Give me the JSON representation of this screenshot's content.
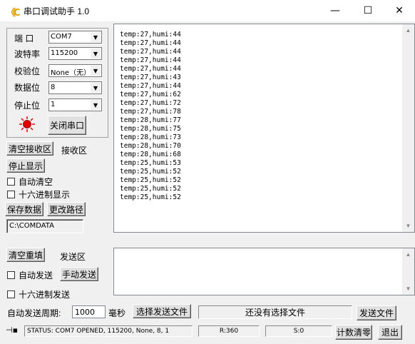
{
  "titlebar": {
    "app_title": "串口调试助手 1.0",
    "app_icon": "app-logo-icon",
    "minimize_glyph": "—",
    "maximize_glyph": "☐",
    "close_glyph": "✕"
  },
  "settings": {
    "port_label": "端  口",
    "port_value": "COM7",
    "baud_label": "波特率",
    "baud_value": "115200",
    "parity_label": "校验位",
    "parity_value": "None（无）",
    "databits_label": "数据位",
    "databits_value": "8",
    "stopbits_label": "停止位",
    "stopbits_value": "1",
    "close_port_label": "关闭串口",
    "status_led_color": "#e00000"
  },
  "receive": {
    "clear_label": "清空接收区",
    "area_label": "接收区",
    "stop_display_label": "停止显示",
    "auto_clear_label": "自动清空",
    "hex_display_label": "十六进制显示",
    "save_data_label": "保存数据",
    "change_path_label": "更改路径",
    "path_value": "C:\\COMDATA",
    "lines": [
      "temp:27,humi:44",
      "temp:27,humi:44",
      "temp:27,humi:44",
      "temp:27,humi:44",
      "temp:27,humi:44",
      "temp:27,humi:43",
      "temp:27,humi:44",
      "temp:27,humi:62",
      "temp:27,humi:72",
      "temp:27,humi:78",
      "temp:28,humi:77",
      "temp:28,humi:75",
      "temp:28,humi:73",
      "temp:28,humi:70",
      "temp:28,humi:68",
      "temp:25,humi:53",
      "temp:25,humi:52",
      "temp:25,humi:52",
      "temp:25,humi:52",
      "temp:25,humi:52"
    ]
  },
  "send": {
    "clear_label": "清空重填",
    "area_label": "发送区",
    "auto_send_label": "自动发送",
    "manual_send_label": "手动发送",
    "hex_send_label": "十六进制发送",
    "period_label": "自动发送周期:",
    "period_value": "1000",
    "period_unit": "毫秒",
    "choose_file_label": "选择发送文件",
    "file_status": "还没有选择文件",
    "send_file_label": "发送文件"
  },
  "statusbar": {
    "pin_icon": "pin-icon",
    "status_text": "STATUS: COM7 OPENED, 115200, None, 8, 1",
    "rx_count": "R:360",
    "tx_count": "S:0",
    "reset_count_label": "计数清零",
    "exit_label": "退出"
  }
}
